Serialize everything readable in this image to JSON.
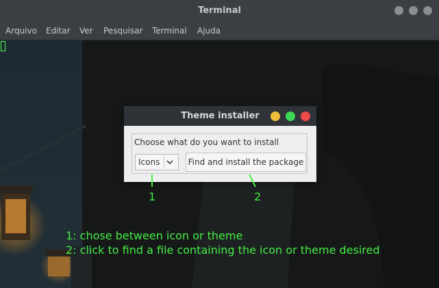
{
  "window": {
    "title": "Terminal",
    "menu": [
      "Arquivo",
      "Editar",
      "Ver",
      "Pesquisar",
      "Terminal",
      "Ajuda"
    ]
  },
  "dialog": {
    "title": "Theme installer",
    "group_label": "Choose what do you want to install",
    "type_select": {
      "value": "Icons"
    },
    "install_button": "Find and install the package"
  },
  "annotations": {
    "marker_1": "1",
    "marker_2": "2",
    "notes": [
      "1: chose between icon or theme",
      "2: click to find a file containing the icon or theme desired"
    ]
  },
  "colors": {
    "annotation": "#44ee44",
    "dot_yellow": "#f0be3c",
    "dot_green": "#3cd754",
    "dot_red": "#f04a4a"
  },
  "icons": [
    "minimize-icon",
    "maximize-icon",
    "close-icon",
    "chevron-down-icon"
  ]
}
